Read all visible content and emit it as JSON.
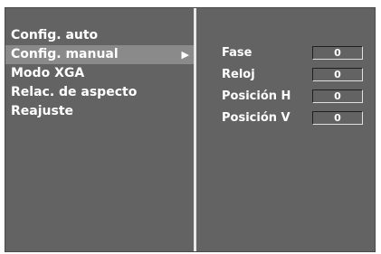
{
  "menu": {
    "items": [
      {
        "label": "Config. auto"
      },
      {
        "label": "Config. manual",
        "selected": true,
        "arrow": "▶"
      },
      {
        "label": "Modo XGA"
      },
      {
        "label": "Relac. de aspecto"
      },
      {
        "label": "Reajuste"
      }
    ]
  },
  "manual_settings": [
    {
      "label": "Fase",
      "value": "0"
    },
    {
      "label": "Reloj",
      "value": "0"
    },
    {
      "label": "Posición H",
      "value": "0"
    },
    {
      "label": "Posición V",
      "value": "0"
    }
  ],
  "colors": {
    "panel_background": "#636363",
    "selection_highlight": "#8a8a8a",
    "divider": "#e8e8e8",
    "text": "#ffffff"
  }
}
